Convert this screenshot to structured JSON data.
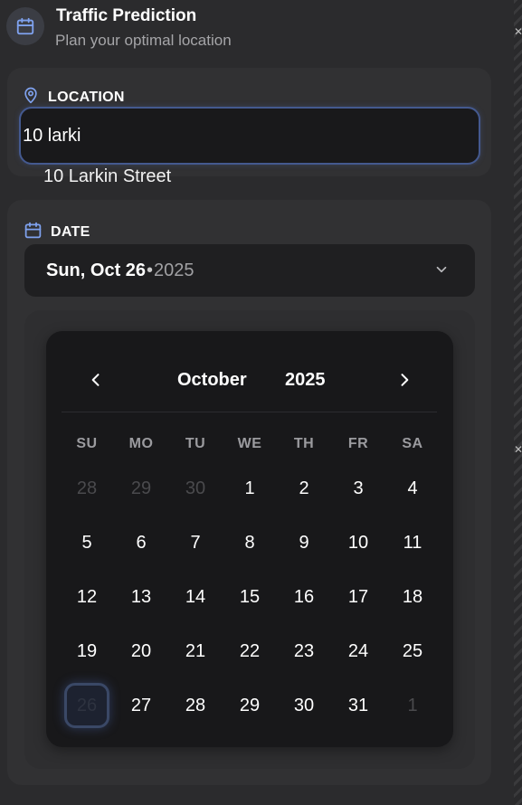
{
  "header": {
    "icon": "calendar-icon",
    "title": "Traffic Prediction",
    "subtitle": "Plan your optimal location"
  },
  "location": {
    "label": "LOCATION",
    "icon": "map-pin-icon",
    "value": "10 larki",
    "suggestion": "10 Larkin Street"
  },
  "date": {
    "label": "DATE",
    "icon": "calendar-icon",
    "selected_text": "Sun, Oct 26",
    "separator": "•",
    "selected_year": "2025"
  },
  "calendar": {
    "month": "October",
    "year": "2025",
    "weekdays": [
      "SU",
      "MO",
      "TU",
      "WE",
      "TH",
      "FR",
      "SA"
    ],
    "days": [
      [
        "28",
        "29",
        "30",
        "1",
        "2",
        "3",
        "4"
      ],
      [
        "5",
        "6",
        "7",
        "8",
        "9",
        "10",
        "11"
      ],
      [
        "12",
        "13",
        "14",
        "15",
        "16",
        "17",
        "18"
      ],
      [
        "19",
        "20",
        "21",
        "22",
        "23",
        "24",
        "25"
      ],
      [
        "26",
        "27",
        "28",
        "29",
        "30",
        "31",
        "1"
      ]
    ],
    "selected_day": "26"
  },
  "colors": {
    "accent": "#7fa2ef",
    "background": "#2b2b2d",
    "card": "#313133",
    "calendar": "#18181a"
  }
}
